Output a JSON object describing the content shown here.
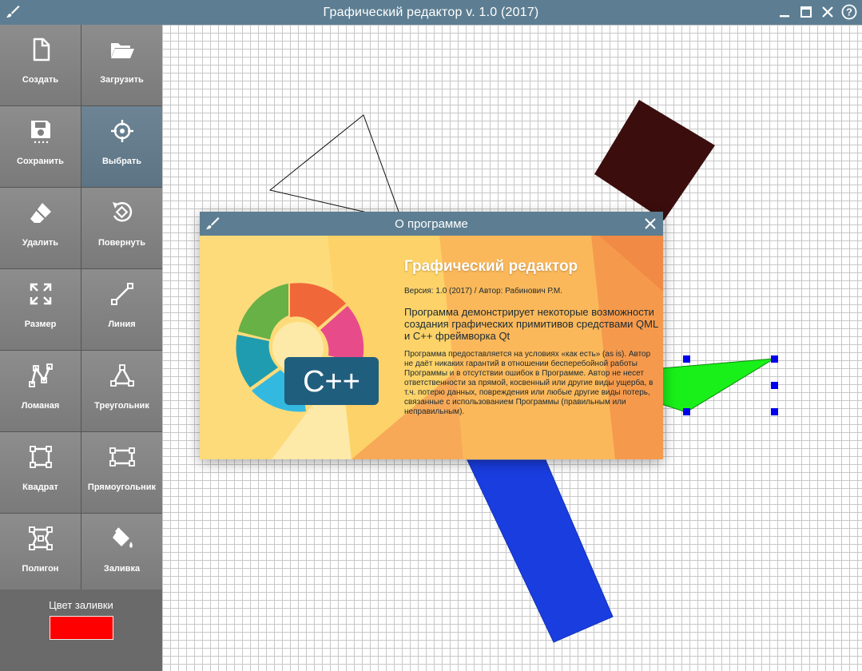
{
  "app": {
    "title": "Графический редактор v. 1.0 (2017)",
    "icon": "brush-icon",
    "controls": [
      "minimize-icon",
      "maximize-icon",
      "close-icon",
      "help-icon"
    ]
  },
  "tools": [
    {
      "label": "Создать",
      "icon": "new-file-icon"
    },
    {
      "label": "Загрузить",
      "icon": "folder-open-icon"
    },
    {
      "label": "Сохранить",
      "icon": "save-icon"
    },
    {
      "label": "Выбрать",
      "icon": "crosshair-icon",
      "active": true
    },
    {
      "label": "Удалить",
      "icon": "eraser-icon"
    },
    {
      "label": "Повернуть",
      "icon": "rotate-icon"
    },
    {
      "label": "Размер",
      "icon": "resize-icon"
    },
    {
      "label": "Линия",
      "icon": "line-icon"
    },
    {
      "label": "Ломаная",
      "icon": "polyline-icon"
    },
    {
      "label": "Треугольник",
      "icon": "triangle-icon"
    },
    {
      "label": "Квадрат",
      "icon": "square-icon"
    },
    {
      "label": "Прямоугольник",
      "icon": "rectangle-icon"
    },
    {
      "label": "Полигон",
      "icon": "polygon-icon"
    },
    {
      "label": "Заливка",
      "icon": "fill-bucket-icon"
    }
  ],
  "fill": {
    "label": "Цвет заливки",
    "color": "#ff0000"
  },
  "dialog": {
    "title": "О программе",
    "heading": "Графический редактор",
    "version": "Версия: 1.0 (2017) / Автор: Рабинович Р.М.",
    "description": "Программа демонстрирует некоторые возможности создания графических примитивов средствами QML и C++ фреймворка Qt",
    "legal": "Программа предоставляется на условиях «как есть» (as is). Автор не даёт никаких гарантий в отношении бесперебойной работы Программы и в отсутствии ошибок в Программе. Автор не несет ответственности за прямой, косвенный или другие виды ущерба, в т.ч. потерю данных, повреждения или любые другие виды потерь, связанные с использованием Программы (правильным или неправильным).",
    "logo_text": "C++"
  },
  "colors": {
    "titlebar": "#5d7e92",
    "square": "#3b0d0d",
    "bar": "#1a3de0",
    "green": "#19f019",
    "handles": "#0000ee"
  }
}
